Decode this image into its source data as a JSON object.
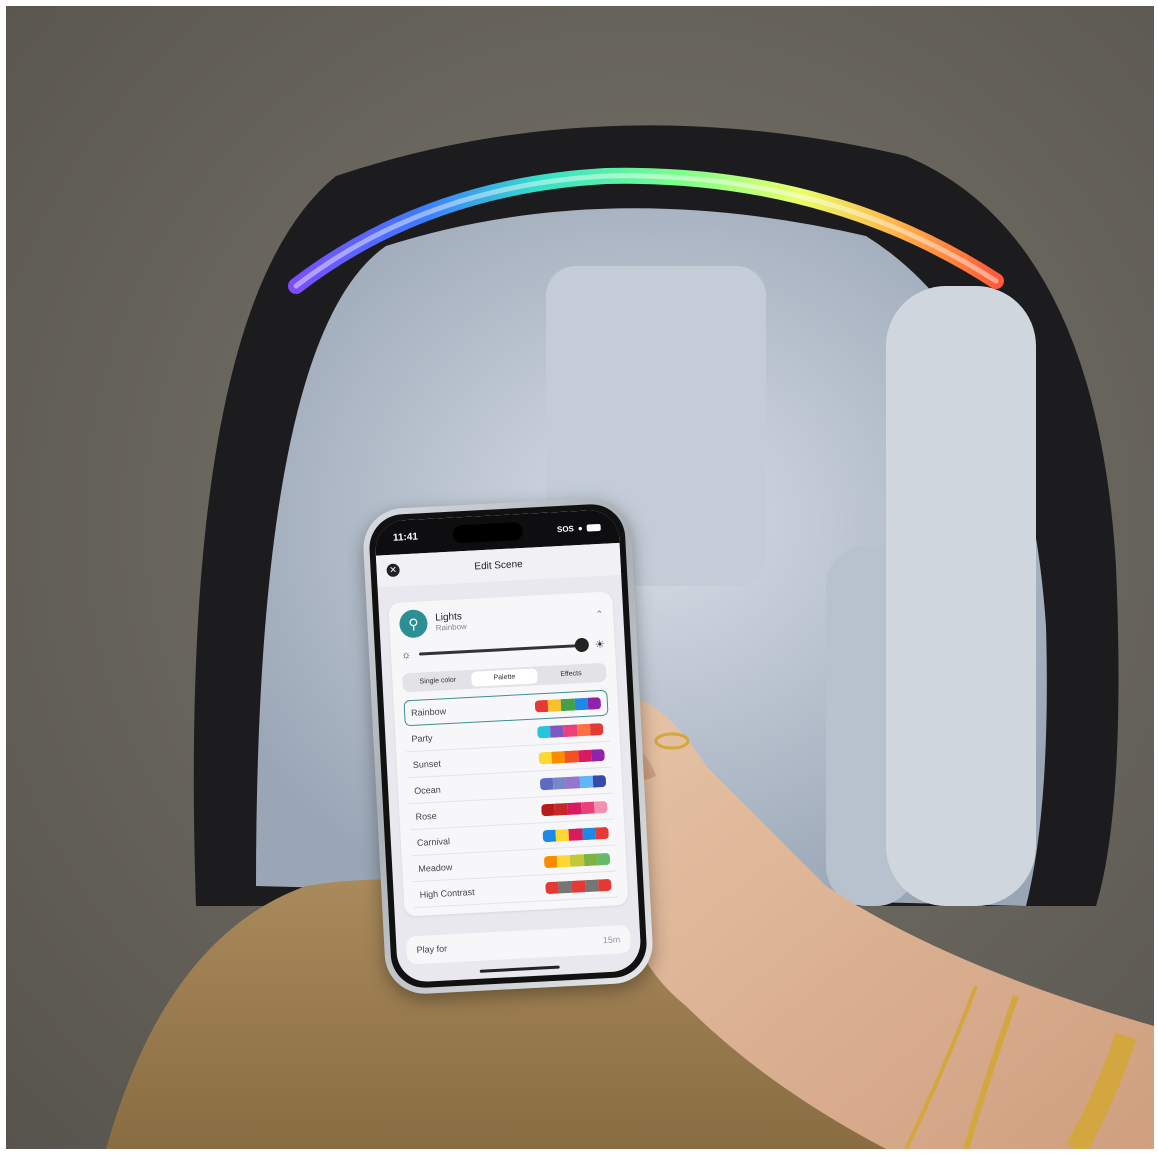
{
  "status": {
    "time": "11:41",
    "signal": "SOS"
  },
  "sheet": {
    "title": "Edit Scene",
    "close_icon": "close-icon"
  },
  "lights": {
    "title": "Lights",
    "subtitle": "Rainbow",
    "icon": "lightbulb-icon",
    "brightness": 0.95
  },
  "tabs": [
    {
      "label": "Single color",
      "selected": false
    },
    {
      "label": "Palette",
      "selected": true
    },
    {
      "label": "Effects",
      "selected": false
    }
  ],
  "palettes": [
    {
      "name": "Rainbow",
      "selected": true,
      "colors": [
        "#e53935",
        "#fbc02d",
        "#43a047",
        "#1e88e5",
        "#8e24aa"
      ]
    },
    {
      "name": "Party",
      "selected": false,
      "colors": [
        "#26c6da",
        "#7e57c2",
        "#ec407a",
        "#ff7043",
        "#e53935"
      ]
    },
    {
      "name": "Sunset",
      "selected": false,
      "colors": [
        "#fdd835",
        "#fb8c00",
        "#f4511e",
        "#d81b60",
        "#8e24aa"
      ]
    },
    {
      "name": "Ocean",
      "selected": false,
      "colors": [
        "#5c6bc0",
        "#7986cb",
        "#9575cd",
        "#64b5f6",
        "#3949ab"
      ]
    },
    {
      "name": "Rose",
      "selected": false,
      "colors": [
        "#b71c1c",
        "#c62828",
        "#d81b60",
        "#ec407a",
        "#f48fb1"
      ]
    },
    {
      "name": "Carnival",
      "selected": false,
      "colors": [
        "#1e88e5",
        "#fdd835",
        "#d81b60",
        "#1e88e5",
        "#e53935"
      ]
    },
    {
      "name": "Meadow",
      "selected": false,
      "colors": [
        "#fb8c00",
        "#fdd835",
        "#c0ca33",
        "#7cb342",
        "#66bb6a"
      ]
    },
    {
      "name": "High Contrast",
      "selected": false,
      "colors": [
        "#e53935",
        "#757575",
        "#e53935",
        "#757575",
        "#e53935"
      ]
    }
  ],
  "play_for": {
    "label": "Play for",
    "value": "15m"
  },
  "colors": {
    "accent": "#2c8f93",
    "canopy_light": "rainbow"
  }
}
